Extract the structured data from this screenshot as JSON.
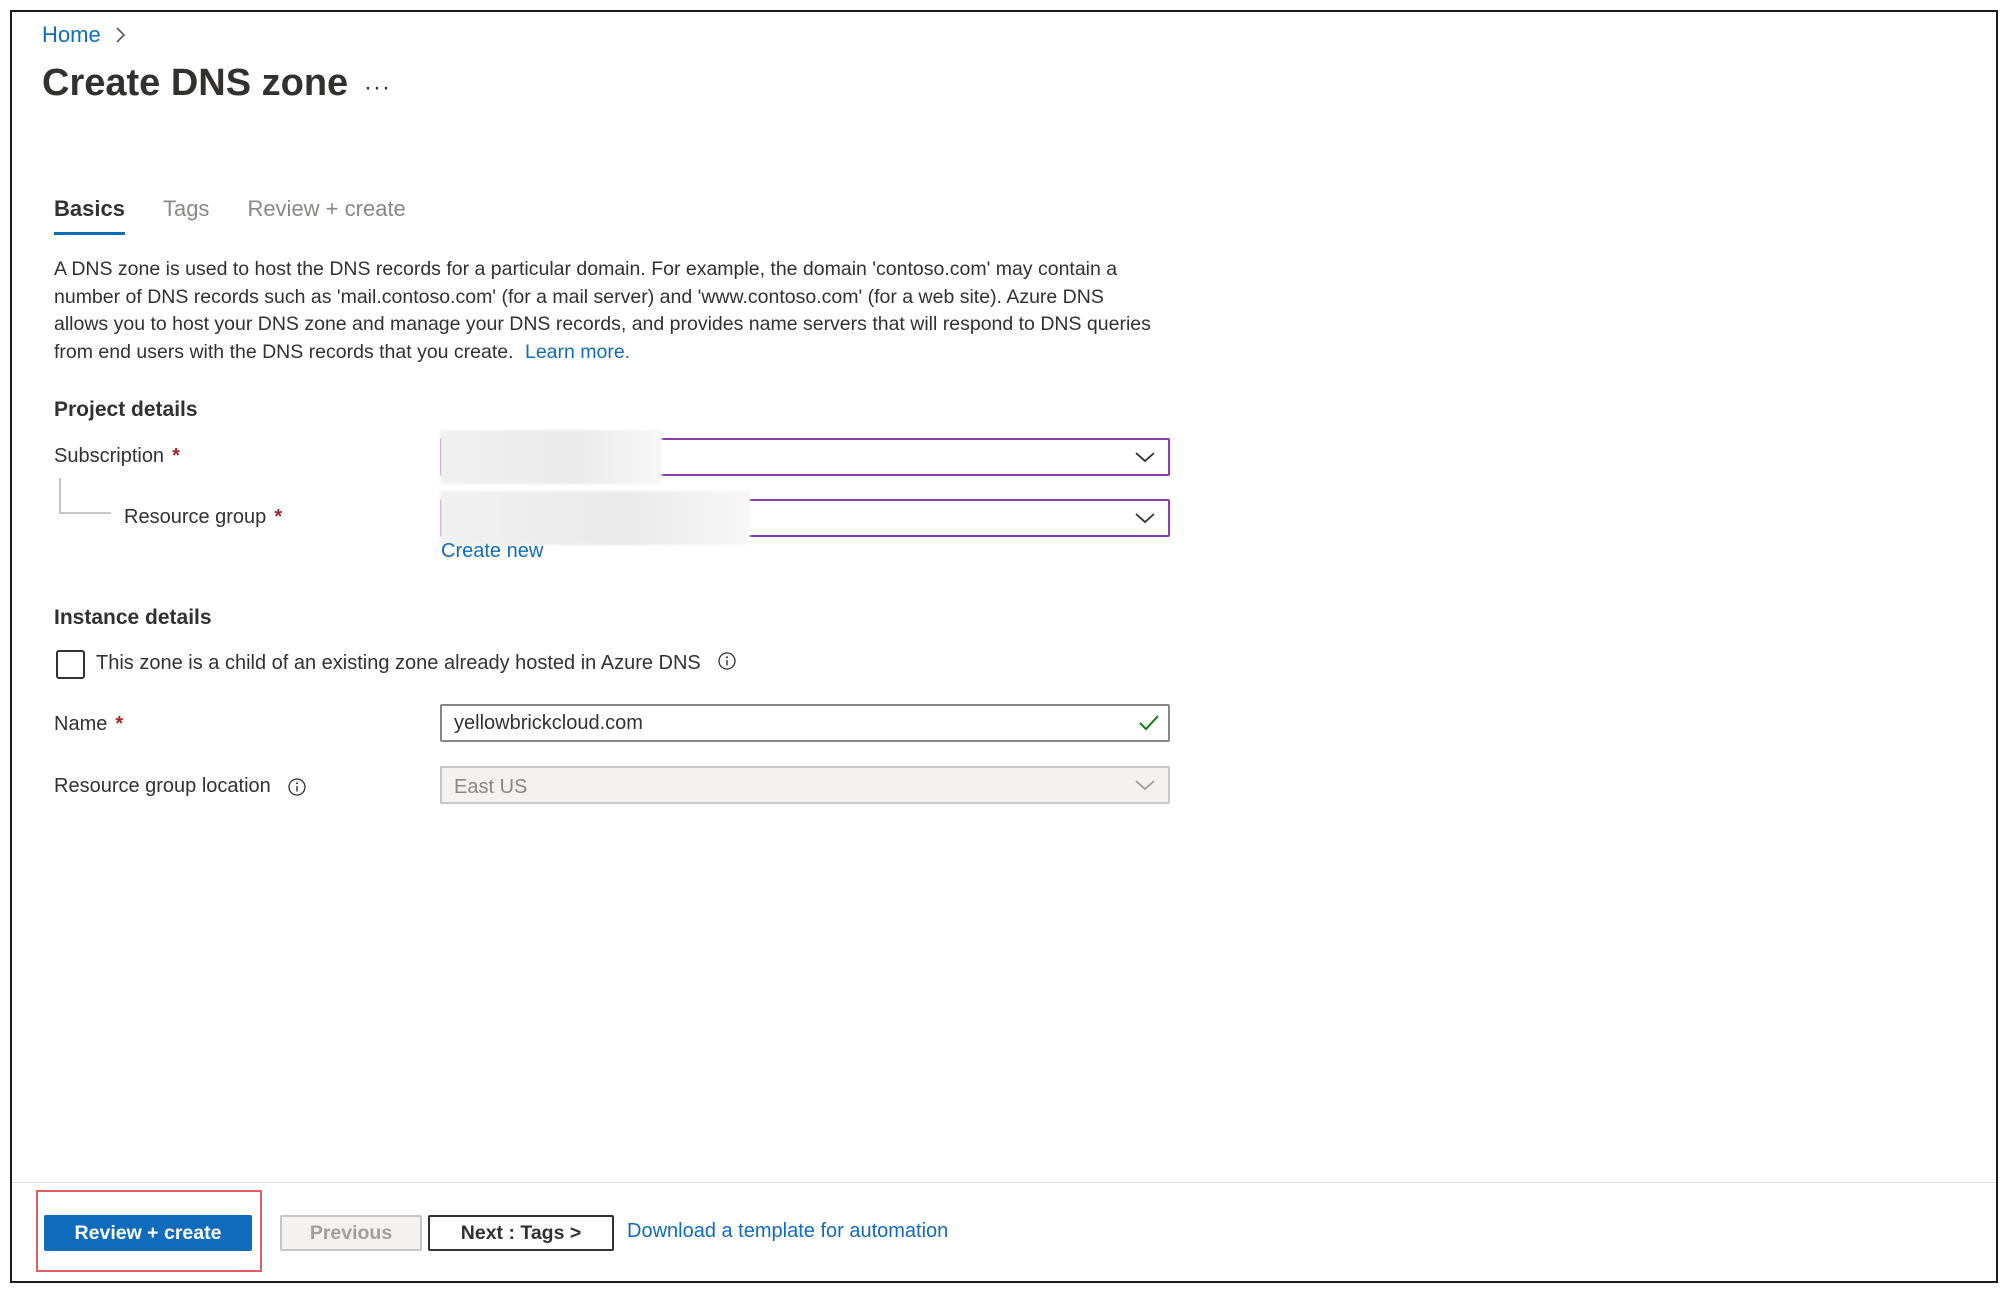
{
  "breadcrumb": {
    "home": "Home"
  },
  "page": {
    "title": "Create DNS zone",
    "more": "···"
  },
  "tabs": [
    {
      "label": "Basics",
      "active": true
    },
    {
      "label": "Tags",
      "active": false
    },
    {
      "label": "Review + create",
      "active": false
    }
  ],
  "description": {
    "text": "A DNS zone is used to host the DNS records for a particular domain. For example, the domain 'contoso.com' may contain a number of DNS records such as 'mail.contoso.com' (for a mail server) and 'www.contoso.com' (for a web site). Azure DNS allows you to host your DNS zone and manage your DNS records, and provides name servers that will respond to DNS queries from end users with the DNS records that you create.",
    "learn_more": "Learn more."
  },
  "project_details": {
    "title": "Project details",
    "subscription_label": "Subscription",
    "resource_group_label": "Resource group",
    "required_mark": "*",
    "create_new": "Create new"
  },
  "instance_details": {
    "title": "Instance details",
    "child_zone_label": "This zone is a child of an existing zone already hosted in Azure DNS",
    "name_label": "Name",
    "name_value": "yellowbrickcloud.com",
    "location_label": "Resource group location",
    "location_value": "East US"
  },
  "footer": {
    "review_create": "Review + create",
    "previous": "Previous",
    "next": "Next : Tags >",
    "download_template": "Download a template for automation"
  },
  "colors": {
    "accent": "#0f6cbd",
    "required": "#a4262c",
    "focus_border": "#8a3ea8",
    "valid_check": "#107c10",
    "highlight": "#e35f5f"
  }
}
